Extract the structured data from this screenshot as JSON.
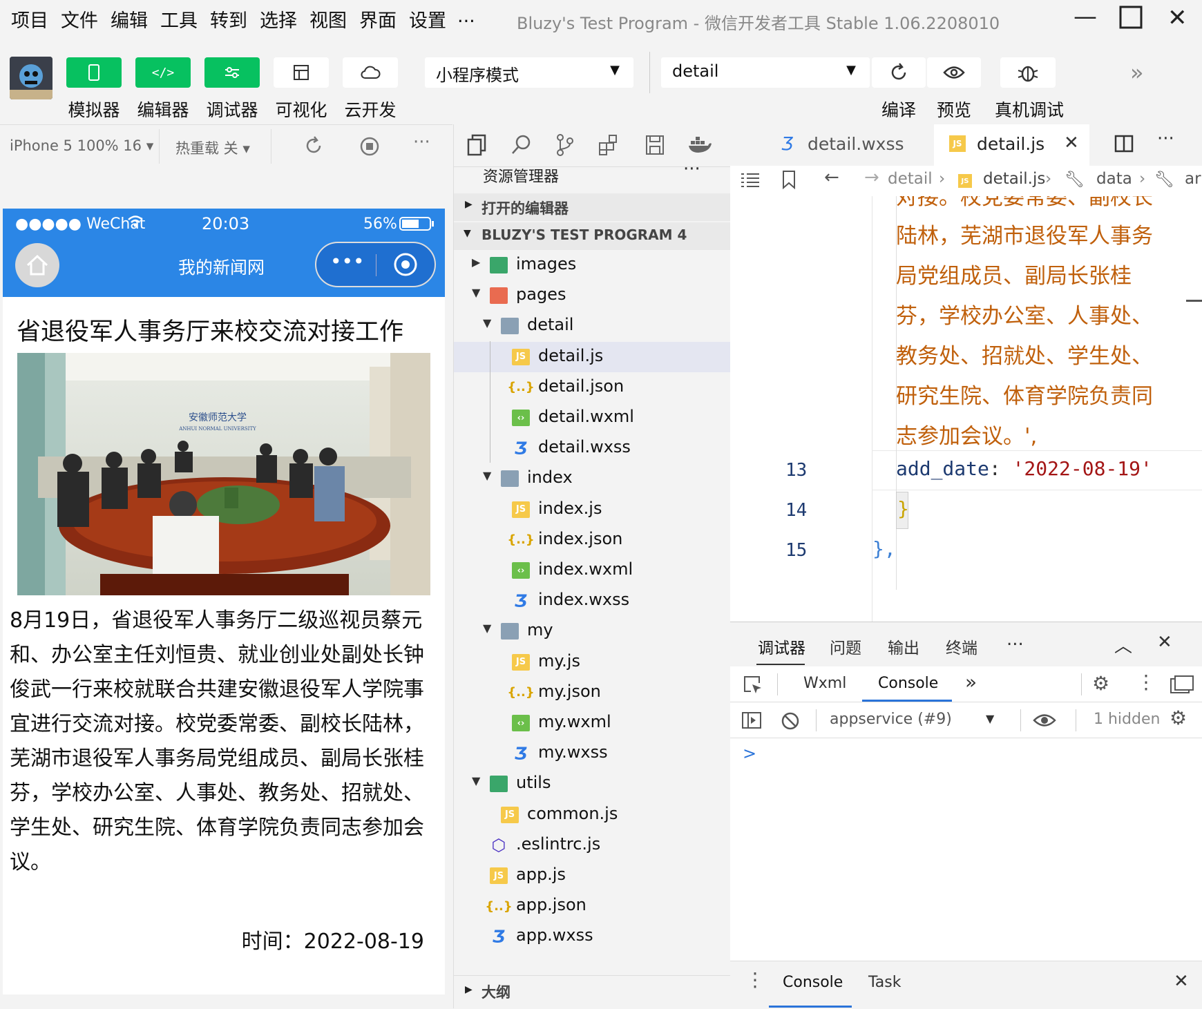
{
  "menu": [
    "项目",
    "文件",
    "编辑",
    "工具",
    "转到",
    "选择",
    "视图",
    "界面",
    "设置",
    "..."
  ],
  "window": {
    "title": "Bluzy's Test Program",
    "subtitle": "- 微信开发者工具 Stable 1.06.2208010"
  },
  "toolbar": {
    "simulator": "模拟器",
    "editor": "编辑器",
    "debugger": "调试器",
    "visual": "可视化",
    "cloud": "云开发",
    "mode": "小程序模式",
    "page": "detail",
    "compile": "编译",
    "preview": "预览",
    "device_debug": "真机调试"
  },
  "simbar": {
    "device": "iPhone 5 100% 16",
    "hot_reload": "热重载 关"
  },
  "phone": {
    "carrier": "WeChat",
    "time": "20:03",
    "battery": "56%",
    "nav_title": "我的新闻网",
    "article_title": "省退役军人事务厅来校交流对接工作",
    "photo_sign": "安徽师范大学",
    "photo_sign_en": "ANHUI NORMAL UNIVERSITY",
    "body": "8月19日，省退役军人事务厅二级巡视员蔡元和、办公室主任刘恒贵、就业创业处副处长钟俊武一行来校就联合共建安徽退役军人学院事宜进行交流对接。校党委常委、副校长陆林，芜湖市退役军人事务局党组成员、副局长张桂芬，学校办公室、人事处、教务处、招就处、学生处、研究生院、体育学院负责同志参加会议。",
    "date": "时间：2022-08-19"
  },
  "explorer": {
    "title": "资源管理器",
    "open_editors": "打开的编辑器",
    "project": "BLUZY'S TEST PROGRAM 4",
    "outline": "大纲",
    "tree": [
      {
        "name": "images",
        "type": "folder-green",
        "depth": 0,
        "arrow": "▶"
      },
      {
        "name": "pages",
        "type": "folder-red",
        "depth": 0,
        "arrow": "▼"
      },
      {
        "name": "detail",
        "type": "folder",
        "depth": 1,
        "arrow": "▼"
      },
      {
        "name": "detail.js",
        "type": "js",
        "depth": 2,
        "selected": true
      },
      {
        "name": "detail.json",
        "type": "json",
        "depth": 2
      },
      {
        "name": "detail.wxml",
        "type": "wxml",
        "depth": 2
      },
      {
        "name": "detail.wxss",
        "type": "wxss",
        "depth": 2
      },
      {
        "name": "index",
        "type": "folder",
        "depth": 1,
        "arrow": "▼"
      },
      {
        "name": "index.js",
        "type": "js",
        "depth": 2
      },
      {
        "name": "index.json",
        "type": "json",
        "depth": 2
      },
      {
        "name": "index.wxml",
        "type": "wxml",
        "depth": 2
      },
      {
        "name": "index.wxss",
        "type": "wxss",
        "depth": 2
      },
      {
        "name": "my",
        "type": "folder",
        "depth": 1,
        "arrow": "▼"
      },
      {
        "name": "my.js",
        "type": "js",
        "depth": 2
      },
      {
        "name": "my.json",
        "type": "json",
        "depth": 2
      },
      {
        "name": "my.wxml",
        "type": "wxml",
        "depth": 2
      },
      {
        "name": "my.wxss",
        "type": "wxss",
        "depth": 2
      },
      {
        "name": "utils",
        "type": "folder-green",
        "depth": 0,
        "arrow": "▼"
      },
      {
        "name": "common.js",
        "type": "js",
        "depth": 1
      },
      {
        "name": ".eslintrc.js",
        "type": "eslint",
        "depth": 0
      },
      {
        "name": "app.js",
        "type": "js",
        "depth": 0
      },
      {
        "name": "app.json",
        "type": "json",
        "depth": 0
      },
      {
        "name": "app.wxss",
        "type": "wxss",
        "depth": 0
      }
    ]
  },
  "editor": {
    "tabs": [
      "detail.wxss",
      "detail.js"
    ],
    "breadcrumb": [
      "detail",
      "detail.js",
      "data",
      "ar"
    ],
    "code_text": [
      "对接。校党委常委、副校长",
      "陆林，芜湖市退役军人事务",
      "局党组成员、副局长张桂",
      "芬，学校办公室、人事处、",
      "教务处、招就处、学生处、",
      "研究生院、体育学院负责同",
      "志参加会议。',"
    ],
    "line13_key": "add_date",
    "line13_value": "'2022-08-19'",
    "line14": "}",
    "line15": "},",
    "line_numbers": [
      "13",
      "14",
      "15"
    ]
  },
  "debug": {
    "tabs": [
      "调试器",
      "问题",
      "输出",
      "终端",
      "..."
    ],
    "subtabs": [
      "Wxml",
      "Console"
    ],
    "context": "appservice (#9)",
    "hidden": "1 hidden",
    "prompt": ">",
    "bottom_tabs": [
      "Console",
      "Task"
    ]
  }
}
